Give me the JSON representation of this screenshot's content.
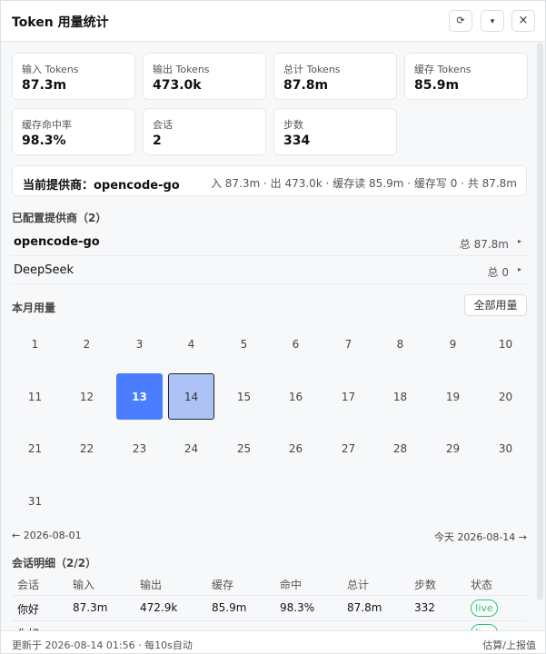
{
  "window": {
    "title": "Token 用量统计",
    "buttons": {
      "refresh": "⟳",
      "menu": "▾",
      "close": "×"
    }
  },
  "stats": [
    {
      "label": "输入 Tokens",
      "value": "87.3m"
    },
    {
      "label": "输出 Tokens",
      "value": "473.0k"
    },
    {
      "label": "总计 Tokens",
      "value": "87.8m"
    },
    {
      "label": "缓存 Tokens",
      "value": "85.9m"
    },
    {
      "label": "缓存命中率",
      "value": "98.3%"
    },
    {
      "label": "会话",
      "value": "2"
    },
    {
      "label": "步数",
      "value": "334"
    }
  ],
  "current_provider": {
    "label": "当前提供商：opencode-go",
    "stats": "入 87.3m · 出 473.0k · 缓存读 85.9m · 缓存写 0 · 共 87.8m"
  },
  "providers": {
    "title": "已配置提供商（2）",
    "items": [
      {
        "name": "opencode-go",
        "total": "总 87.8m",
        "arrow": "▸"
      },
      {
        "name": "DeepSeek",
        "total": "总 0",
        "arrow": "▸"
      }
    ]
  },
  "month": {
    "title": "本月用量",
    "all_button": "全部用量",
    "days": [
      "1",
      "2",
      "3",
      "4",
      "5",
      "6",
      "7",
      "8",
      "9",
      "10",
      "11",
      "12",
      "13",
      "14",
      "15",
      "16",
      "17",
      "18",
      "19",
      "20",
      "21",
      "22",
      "23",
      "24",
      "25",
      "26",
      "27",
      "28",
      "29",
      "30",
      "31"
    ],
    "today_day": "13",
    "selected_day": "14",
    "prev_link": "← 2026-08-01",
    "next_link": "今天 2026-08-14 →"
  },
  "sessions": {
    "title": "会话明细（2/2）",
    "columns": [
      "会话",
      "输入",
      "输出",
      "缓存",
      "命中",
      "总计",
      "步数",
      "状态"
    ],
    "rows": [
      {
        "name": "你好",
        "input": "87.3m",
        "output": "472.9k",
        "cache": "85.9m",
        "hit": "98.3%",
        "total": "87.8m",
        "steps": "332",
        "status": "live"
      },
      {
        "name": "你好",
        "input": "",
        "output": "",
        "cache": "",
        "hit": "",
        "total": "",
        "steps": "",
        "status": "live"
      }
    ]
  },
  "footer": {
    "updated": "更新于 2026-08-14 01:56 · 每10s自动",
    "note": "估算/上报值"
  },
  "colors": {
    "accent": "#4a7dff",
    "selected": "#aec3f5",
    "live": "#2fbf71"
  }
}
